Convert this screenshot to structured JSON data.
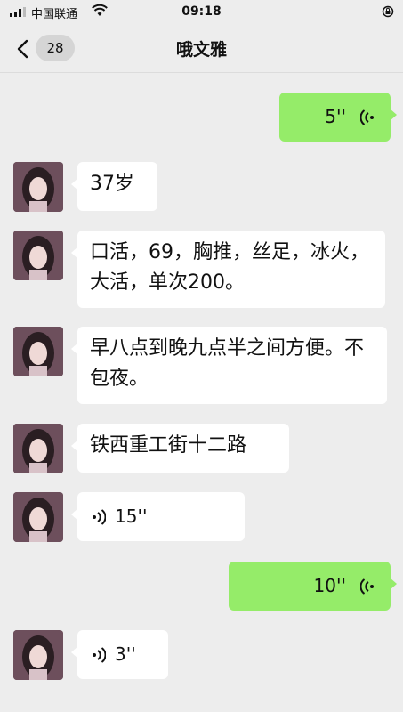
{
  "status_bar": {
    "carrier": "中国联通",
    "time": "09:18"
  },
  "nav": {
    "back_count": "28",
    "title": "哦文雅"
  },
  "messages": [
    {
      "side": "right",
      "type": "voice",
      "duration": "5''"
    },
    {
      "side": "left",
      "type": "text",
      "text": "37岁"
    },
    {
      "side": "left",
      "type": "text",
      "text": "口活，69，胸推，丝足，冰火，大活，单次200。"
    },
    {
      "side": "left",
      "type": "text",
      "text": "早八点到晚九点半之间方便。不包夜。"
    },
    {
      "side": "left",
      "type": "text",
      "text": "铁西重工街十二路"
    },
    {
      "side": "left",
      "type": "voice",
      "duration": "15''"
    },
    {
      "side": "right",
      "type": "voice",
      "duration": "10''"
    },
    {
      "side": "left",
      "type": "voice",
      "duration": "3''"
    }
  ],
  "colors": {
    "background": "#ededed",
    "bubble_self": "#95ec69",
    "bubble_other": "#ffffff"
  }
}
